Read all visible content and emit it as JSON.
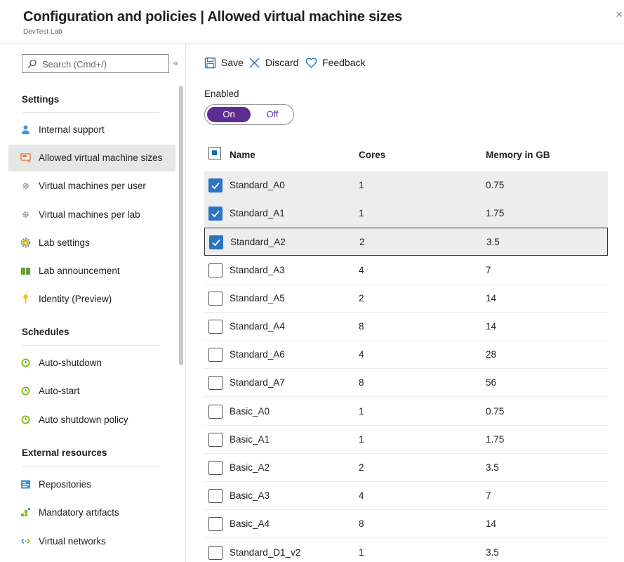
{
  "header": {
    "title": "Configuration and policies | Allowed virtual machine sizes",
    "subtitle": "DevTest Lab",
    "close_glyph": "×"
  },
  "sidebar": {
    "search_placeholder": "Search (Cmd+/)",
    "collapse_glyph": "«",
    "sections": [
      {
        "title": "Settings",
        "items": [
          {
            "label": "Internal support",
            "icon": "person-icon"
          },
          {
            "label": "Allowed virtual machine sizes",
            "icon": "vm-size-icon",
            "selected": true
          },
          {
            "label": "Virtual machines per user",
            "icon": "gear-icon"
          },
          {
            "label": "Virtual machines per lab",
            "icon": "gear-icon"
          },
          {
            "label": "Lab settings",
            "icon": "gear-color-icon"
          },
          {
            "label": "Lab announcement",
            "icon": "book-icon"
          },
          {
            "label": "Identity (Preview)",
            "icon": "key-icon"
          }
        ]
      },
      {
        "title": "Schedules",
        "items": [
          {
            "label": "Auto-shutdown",
            "icon": "clock-icon"
          },
          {
            "label": "Auto-start",
            "icon": "clock-icon"
          },
          {
            "label": "Auto shutdown policy",
            "icon": "clock-icon"
          }
        ]
      },
      {
        "title": "External resources",
        "items": [
          {
            "label": "Repositories",
            "icon": "repository-icon"
          },
          {
            "label": "Mandatory artifacts",
            "icon": "artifacts-icon"
          },
          {
            "label": "Virtual networks",
            "icon": "network-icon"
          }
        ]
      }
    ]
  },
  "toolbar": {
    "save_label": "Save",
    "discard_label": "Discard",
    "feedback_label": "Feedback"
  },
  "enabled": {
    "label": "Enabled",
    "on_label": "On",
    "off_label": "Off",
    "value": "On"
  },
  "table": {
    "columns": [
      "Name",
      "Cores",
      "Memory in GB"
    ],
    "rows": [
      {
        "name": "Standard_A0",
        "cores": "1",
        "memory": "0.75",
        "checked": true
      },
      {
        "name": "Standard_A1",
        "cores": "1",
        "memory": "1.75",
        "checked": true
      },
      {
        "name": "Standard_A2",
        "cores": "2",
        "memory": "3.5",
        "checked": true,
        "focused": true
      },
      {
        "name": "Standard_A3",
        "cores": "4",
        "memory": "7",
        "checked": false
      },
      {
        "name": "Standard_A5",
        "cores": "2",
        "memory": "14",
        "checked": false
      },
      {
        "name": "Standard_A4",
        "cores": "8",
        "memory": "14",
        "checked": false
      },
      {
        "name": "Standard_A6",
        "cores": "4",
        "memory": "28",
        "checked": false
      },
      {
        "name": "Standard_A7",
        "cores": "8",
        "memory": "56",
        "checked": false
      },
      {
        "name": "Basic_A0",
        "cores": "1",
        "memory": "0.75",
        "checked": false
      },
      {
        "name": "Basic_A1",
        "cores": "1",
        "memory": "1.75",
        "checked": false
      },
      {
        "name": "Basic_A2",
        "cores": "2",
        "memory": "3.5",
        "checked": false
      },
      {
        "name": "Basic_A3",
        "cores": "4",
        "memory": "7",
        "checked": false
      },
      {
        "name": "Basic_A4",
        "cores": "8",
        "memory": "14",
        "checked": false
      },
      {
        "name": "Standard_D1_v2",
        "cores": "1",
        "memory": "3.5",
        "checked": false
      }
    ]
  },
  "colors": {
    "accent_purple": "#5c2d91",
    "checkbox_blue": "#2b74c4",
    "selected_bg": "#e6e6e6"
  }
}
